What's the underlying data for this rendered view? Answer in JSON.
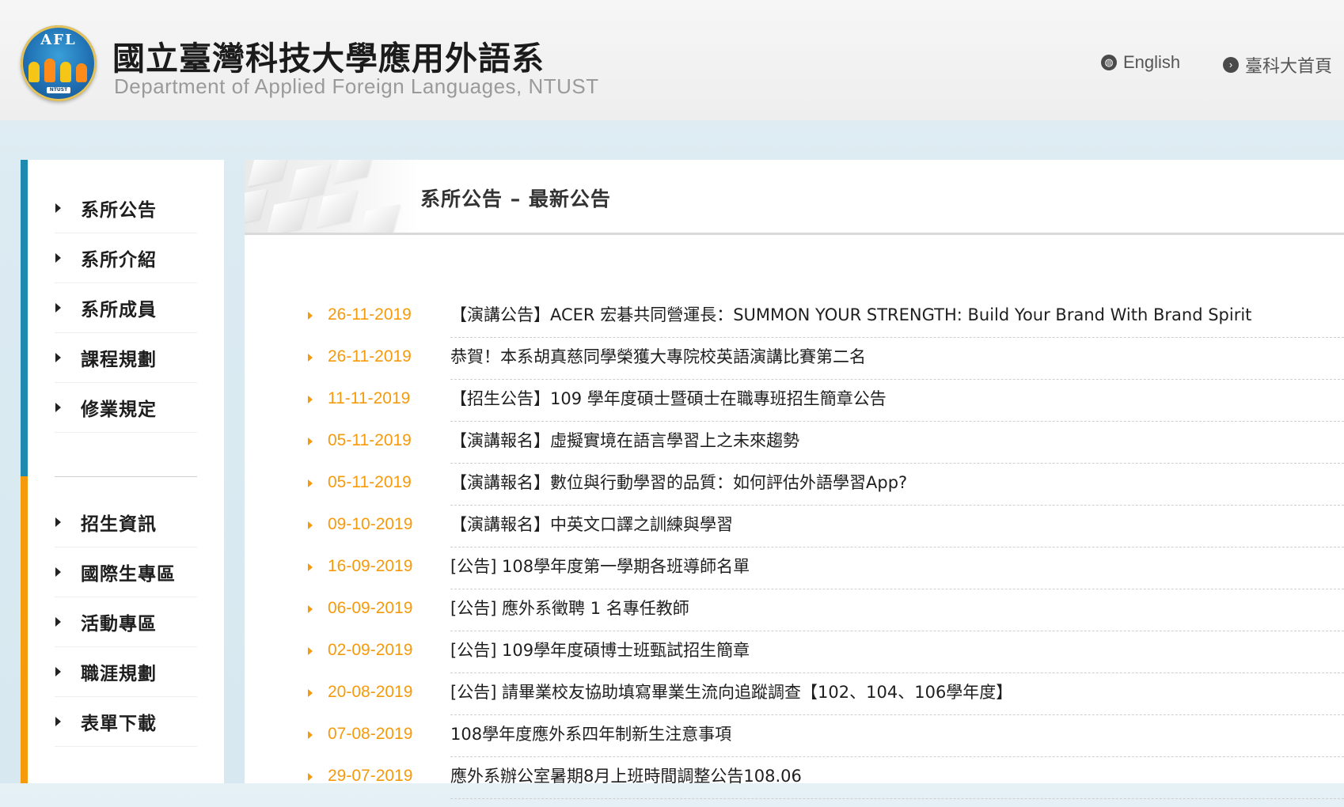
{
  "header": {
    "logo_text": "AFL",
    "logo_sub": "NTUST",
    "title": "國立臺灣科技大學應用外語系",
    "subtitle": "Department of Applied Foreign Languages, NTUST",
    "links": [
      {
        "label": "English",
        "icon": "globe-icon"
      },
      {
        "label": "臺科大首頁",
        "icon": "arrow-circle-right-icon"
      }
    ]
  },
  "sidebar": {
    "primary": [
      "系所公告",
      "系所介紹",
      "系所成員",
      "課程規劃",
      "修業規定"
    ],
    "secondary": [
      "招生資訊",
      "國際生專區",
      "活動專區",
      "職涯規劃",
      "表單下載"
    ],
    "colors": {
      "top_bar": "#1f8ab0",
      "bottom_bar": "#f59a0c"
    }
  },
  "main": {
    "page_title": "系所公告 – 最新公告",
    "news": [
      {
        "date": "26-11-2019",
        "title": "【演講公告】ACER 宏碁共同營運長：SUMMON YOUR STRENGTH: Build Your Brand With Brand Spirit"
      },
      {
        "date": "26-11-2019",
        "title": "恭賀！本系胡真慈同學榮獲大專院校英語演講比賽第二名"
      },
      {
        "date": "11-11-2019",
        "title": "【招生公告】109 學年度碩士暨碩士在職專班招生簡章公告"
      },
      {
        "date": "05-11-2019",
        "title": "【演講報名】虛擬實境在語言學習上之未來趨勢"
      },
      {
        "date": "05-11-2019",
        "title": "【演講報名】數位與行動學習的品質：如何評估外語學習App?"
      },
      {
        "date": "09-10-2019",
        "title": "【演講報名】中英文口譯之訓練與學習"
      },
      {
        "date": "16-09-2019",
        "title": "[公告] 108學年度第一學期各班導師名單"
      },
      {
        "date": "06-09-2019",
        "title": "[公告] 應外系徵聘 1 名專任教師"
      },
      {
        "date": "02-09-2019",
        "title": "[公告] 109學年度碩博士班甄試招生簡章"
      },
      {
        "date": "20-08-2019",
        "title": "[公告] 請畢業校友協助填寫畢業生流向追蹤調查【102、104、106學年度】"
      },
      {
        "date": "07-08-2019",
        "title": "108學年度應外系四年制新生注意事項"
      },
      {
        "date": "29-07-2019",
        "title": "應外系辦公室暑期8月上班時間調整公告108.06"
      }
    ],
    "accent": "#f59a0c"
  }
}
